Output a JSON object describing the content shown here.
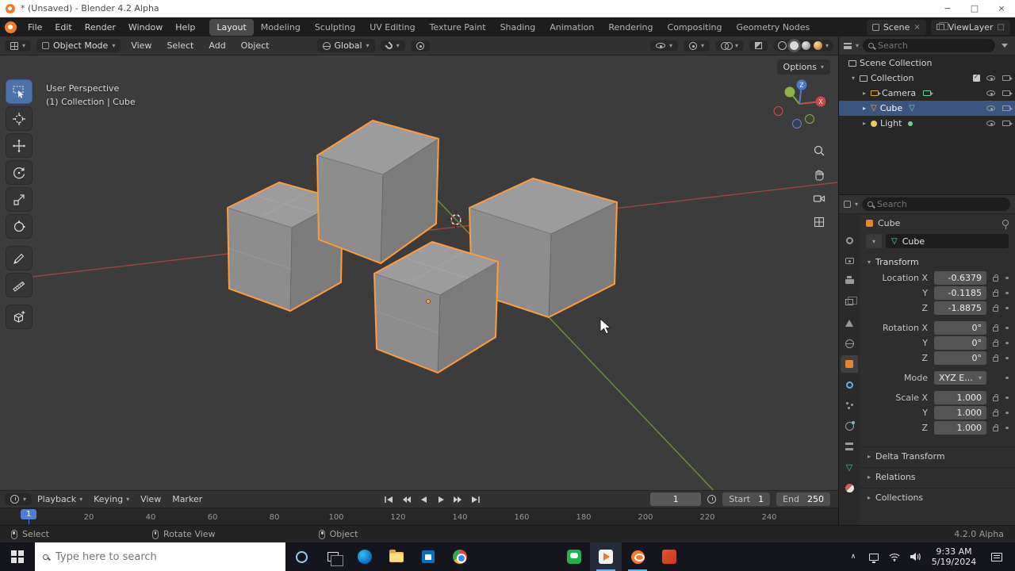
{
  "window": {
    "title": "* (Unsaved) - Blender 4.2 Alpha"
  },
  "icons": {
    "chevron_down": "▾",
    "chevron_right": "▸",
    "chevron_up": "∧",
    "minimize": "−",
    "maximize": "□",
    "close": "×"
  },
  "colors": {
    "accent_orange": "#e8842c",
    "selection_outline": "#ff9b38",
    "active_tool_blue": "#4d72aa",
    "playhead_blue": "#4f7fd0",
    "selected_row_blue": "#3a5680"
  },
  "topbar": {
    "menus": [
      "File",
      "Edit",
      "Render",
      "Window",
      "Help"
    ],
    "workspaces": [
      "Layout",
      "Modeling",
      "Sculpting",
      "UV Editing",
      "Texture Paint",
      "Shading",
      "Animation",
      "Rendering",
      "Compositing",
      "Geometry Nodes"
    ],
    "scene": "Scene",
    "view_layer": "ViewLayer"
  },
  "tool_header": {
    "mode": "Object Mode",
    "menus": [
      "View",
      "Select",
      "Add",
      "Object"
    ],
    "orientation": "Global",
    "options": "Options"
  },
  "viewport": {
    "overlay_line1": "User Perspective",
    "overlay_line2": "(1) Collection | Cube"
  },
  "outliner": {
    "search_placeholder": "Search",
    "items": [
      {
        "label": "Scene Collection"
      },
      {
        "label": "Collection"
      },
      {
        "label": "Camera"
      },
      {
        "label": "Cube"
      },
      {
        "label": "Light"
      }
    ]
  },
  "properties": {
    "search_placeholder": "Search",
    "breadcrumb": "Cube",
    "name": "Cube",
    "transform_title": "Transform",
    "rows": [
      {
        "label": "Location X",
        "value": "-0.6379"
      },
      {
        "label": "Y",
        "value": "-0.1185"
      },
      {
        "label": "Z",
        "value": "-1.8875"
      },
      {
        "label": "Rotation X",
        "value": "0°"
      },
      {
        "label": "Y",
        "value": "0°"
      },
      {
        "label": "Z",
        "value": "0°"
      },
      {
        "label": "Mode",
        "value": "XYZ E..."
      },
      {
        "label": "Scale X",
        "value": "1.000"
      },
      {
        "label": "Y",
        "value": "1.000"
      },
      {
        "label": "Z",
        "value": "1.000"
      }
    ],
    "sections": [
      "Delta Transform",
      "Relations",
      "Collections"
    ]
  },
  "timeline": {
    "menus": [
      "Playback",
      "Keying",
      "View",
      "Marker"
    ],
    "frame": "1",
    "marker": "1",
    "start_label": "Start",
    "start": "1",
    "end_label": "End",
    "end": "250",
    "ticks": [
      "20",
      "40",
      "60",
      "80",
      "100",
      "120",
      "140",
      "160",
      "180",
      "200",
      "220",
      "240"
    ]
  },
  "status": {
    "hints": [
      "Select",
      "Rotate View",
      "Object"
    ],
    "version": "4.2.0 Alpha"
  },
  "taskbar": {
    "search_placeholder": "Type here to search",
    "time": "9:33 AM",
    "date": "5/19/2024"
  }
}
